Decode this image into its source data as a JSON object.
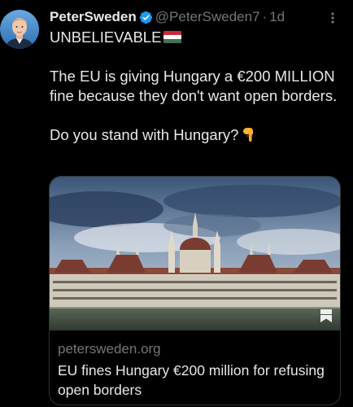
{
  "tweet": {
    "author": {
      "display_name": "PeterSweden",
      "handle": "@PeterSweden7",
      "verified": true
    },
    "separator": "·",
    "timestamp": "1d",
    "text": {
      "line1": "UNBELIEVABLE",
      "line1_emoji": "hungary-flag",
      "paragraph2": "The EU is giving Hungary a €200 MILLION fine because they don't want open borders.",
      "paragraph3": "Do you stand with Hungary?",
      "paragraph3_emoji": "backhand-index-pointing-down"
    },
    "link_card": {
      "domain": "petersweden.org",
      "title": "EU fines Hungary €200 million for refusing open borders",
      "image_description_icon": "bookmark-icon"
    }
  },
  "colors": {
    "background": "#000000",
    "primary_text": "#e7e9ea",
    "secondary_text": "#71767b",
    "verified_blue": "#1d9bf0",
    "card_border": "#2f3336"
  }
}
